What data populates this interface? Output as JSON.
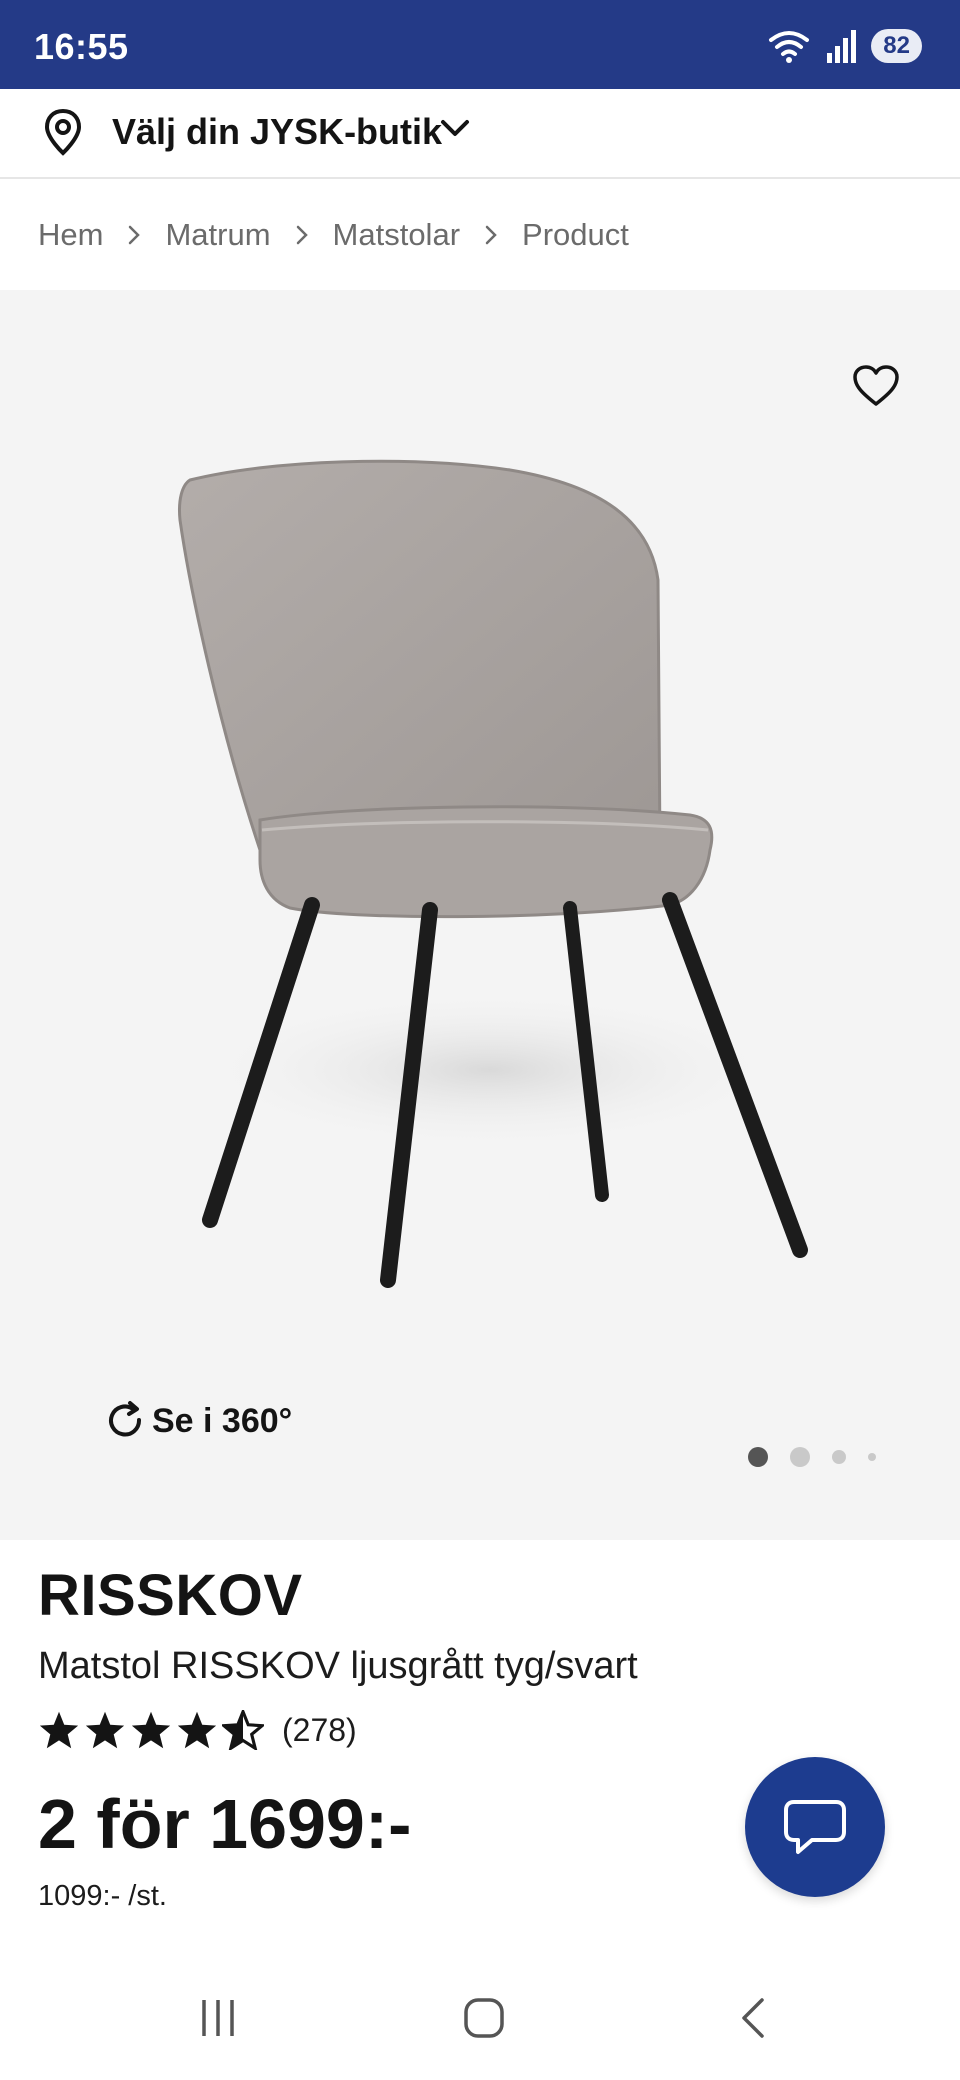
{
  "status_bar": {
    "time": "16:55",
    "battery": "82",
    "wifi_icon": "wifi-icon",
    "signal_icon": "signal-icon"
  },
  "store": {
    "label": "Välj din JYSK-butik"
  },
  "breadcrumb": {
    "items": [
      "Hem",
      "Matrum",
      "Matstolar",
      "Product"
    ]
  },
  "gallery": {
    "view_360_label": "Se i 360°",
    "pages": 4,
    "active_page": 1
  },
  "product": {
    "brand": "RISSKOV",
    "name": "Matstol RISSKOV ljusgrått tyg/svart",
    "rating": 4.5,
    "rating_max": 5,
    "review_count": "(278)",
    "price": "2 för 1699:-",
    "unit_price": "1099:- /st."
  },
  "colors": {
    "brand_blue": "#243a87",
    "chat_blue": "#1d3c8f",
    "gallery_bg": "#f4f4f4"
  }
}
